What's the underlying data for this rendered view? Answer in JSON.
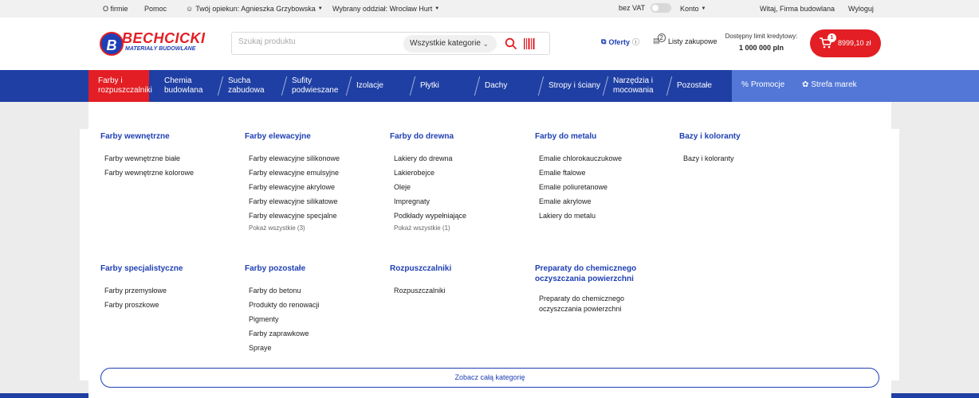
{
  "topbar": {
    "about": "O firmie",
    "help": "Pomoc",
    "advisor": "Twój opiekun: Agnieszka Grzybowska",
    "branch": "Wybrany oddział: Wrocław Hurt",
    "vat": "bez VAT",
    "account": "Konto",
    "welcome": "Witaj, Firma budowlana",
    "logout": "Wyloguj"
  },
  "header": {
    "logo_name": "BECHCICKI",
    "logo_sub": "MATERIAŁY BUDOWLANE",
    "search_placeholder": "Szukaj produktu",
    "category_select": "Wszystkie kategorie",
    "offers": "Oferty",
    "lists_count": "2",
    "lists": "Listy zakupowe",
    "credit_label": "Dostępny limit kredytowy:",
    "credit_amount": "1 000 000 pln",
    "cart_count": "1",
    "cart_total": "8999,10 zł"
  },
  "nav": {
    "items": [
      {
        "l1": "Farby i",
        "l2": "rozpuszczalniki"
      },
      {
        "l1": "Chemia",
        "l2": "budowlana"
      },
      {
        "l1": "Sucha",
        "l2": "zabudowa"
      },
      {
        "l1": "Sufity",
        "l2": "podwieszane"
      },
      {
        "l1": "Izolacje",
        "l2": ""
      },
      {
        "l1": "Płytki",
        "l2": ""
      },
      {
        "l1": "Dachy",
        "l2": ""
      },
      {
        "l1": "Stropy i ściany",
        "l2": ""
      },
      {
        "l1": "Narzędzia i",
        "l2": "mocowania"
      },
      {
        "l1": "Pozostałe",
        "l2": ""
      }
    ],
    "promotions": "Promocje",
    "brands": "Strefa marek"
  },
  "menu": {
    "columns": [
      {
        "title": "Farby wewnętrzne",
        "items": [
          "Farby wewnętrzne białe",
          "Farby wewnętrzne kolorowe"
        ],
        "more": ""
      },
      {
        "title": "Farby elewacyjne",
        "items": [
          "Farby elewacyjne silikonowe",
          "Farby elewacyjne emulsyjne",
          "Farby elewacyjne akrylowe",
          "Farby elewacyjne silikatowe",
          "Farby elewacyjne specjalne"
        ],
        "more": "Pokaż wszystkie (3)"
      },
      {
        "title": "Farby do drewna",
        "items": [
          "Lakiery do drewna",
          "Lakierobejce",
          "Oleje",
          "Impregnaty",
          "Podkłady wypełniające"
        ],
        "more": "Pokaż wszystkie (1)"
      },
      {
        "title": "Farby do metalu",
        "items": [
          "Emalie chlorokauczukowe",
          "Emalie ftalowe",
          "Emalie poliuretanowe",
          "Emalie akrylowe",
          "Lakiery do metalu"
        ],
        "more": ""
      },
      {
        "title": "Bazy i koloranty",
        "items": [
          "Bazy i koloranty"
        ],
        "more": ""
      },
      {
        "title": "Farby specjalistyczne",
        "items": [
          "Farby przemysłowe",
          "Farby proszkowe"
        ],
        "more": ""
      },
      {
        "title": "Farby pozostałe",
        "items": [
          "Farby do betonu",
          "Produkty do renowacji",
          "Pigmenty",
          "Farby zaprawkowe",
          "Spraye"
        ],
        "more": ""
      },
      {
        "title": "Rozpuszczalniki",
        "items": [
          "Rozpuszczalniki"
        ],
        "more": ""
      },
      {
        "title": "Preparaty do chemicznego oczyszczania powierzchni",
        "items": [
          "Preparaty do chemicznego oczyszczania powierzchni"
        ],
        "more": ""
      }
    ],
    "see_all": "Zobacz całą kategorię"
  },
  "colors": {
    "brand_blue": "#1f3fa4",
    "brand_red": "#e31e24",
    "accent_light_blue": "#5377d6"
  }
}
